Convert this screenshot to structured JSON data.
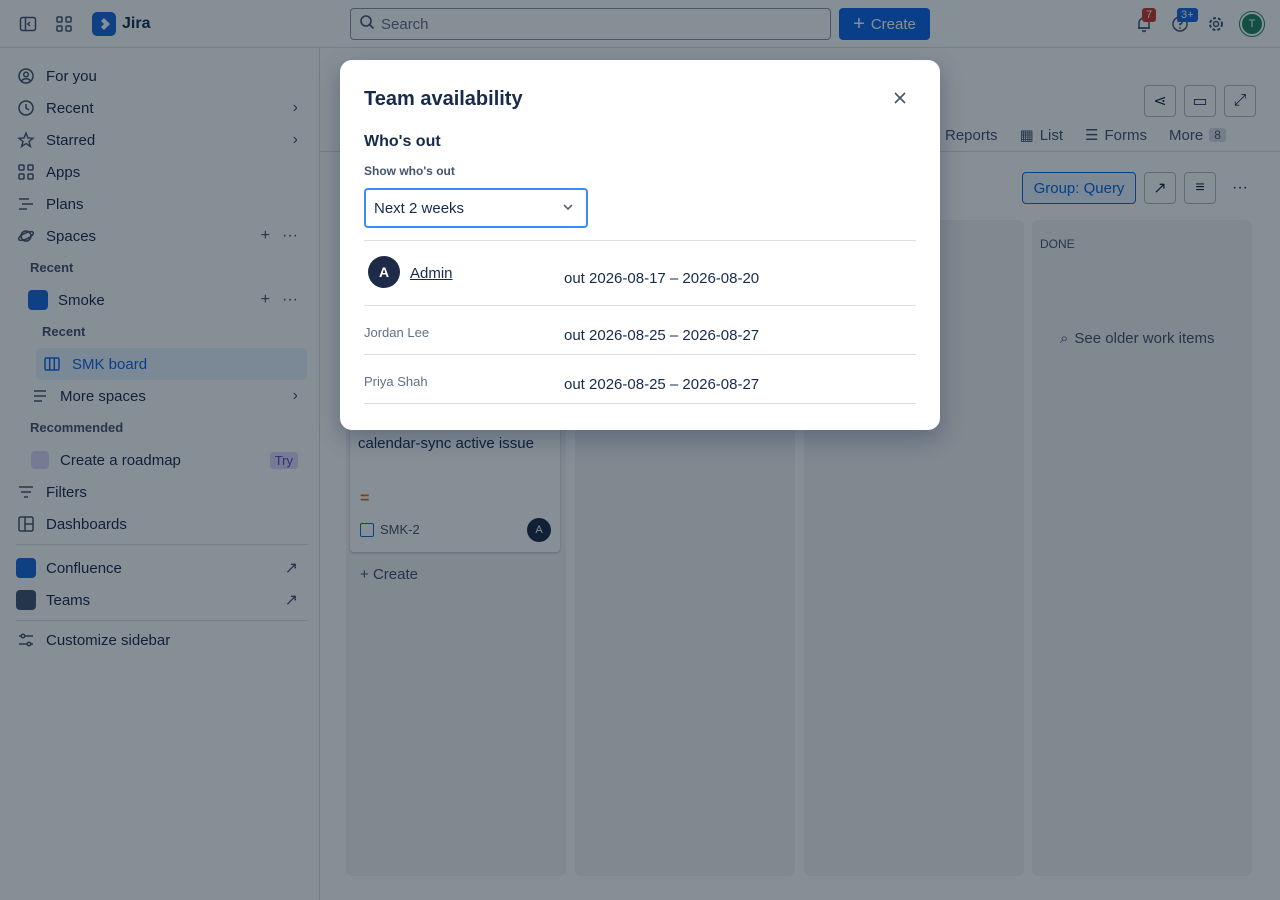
{
  "topbar": {
    "app_name": "Jira",
    "search_placeholder": "Search",
    "create_label": "Create",
    "notifications_count": "7",
    "help_count": "3+",
    "user_initial": "T"
  },
  "sidebar": {
    "items": [
      {
        "label": "For you",
        "icon": "person-circle-icon"
      },
      {
        "label": "Recent",
        "icon": "clock-icon"
      },
      {
        "label": "Starred",
        "icon": "star-icon"
      },
      {
        "label": "Apps",
        "icon": "apps-icon"
      },
      {
        "label": "Plans",
        "icon": "plans-icon"
      },
      {
        "label": "Spaces",
        "icon": "spaces-icon"
      }
    ],
    "section_recent": "Recent",
    "space_name": "Smoke",
    "space_recent": "Recent",
    "board_name": "SMK board",
    "more_spaces": "More spaces",
    "section_recommended": "Recommended",
    "roadmap": "Create a roadmap",
    "try_label": "Try",
    "filters": "Filters",
    "dashboards": "Dashboards",
    "confluence": "Confluence",
    "teams": "Teams",
    "customize": "Customize sidebar"
  },
  "main": {
    "tabs": [
      "Reports",
      "List",
      "Forms",
      "More"
    ],
    "more_count": "8",
    "group_label": "Group: Query",
    "done_column": "DONE",
    "older_items": "See older work items",
    "card_title": "calendar-sync active issue",
    "card_key": "SMK-2",
    "card_avatar": "A",
    "create_in_column": "Create"
  },
  "modal": {
    "title": "Team availability",
    "subtitle": "Who's out",
    "filter_label": "Show who's out",
    "filter_value": "Next 2 weeks",
    "rows": [
      {
        "name": "Admin",
        "initial": "A",
        "dates": "out 2026-08-17 – 2026-08-20"
      },
      {
        "name": "Jordan Lee",
        "dates": "out 2026-08-25 – 2026-08-27"
      },
      {
        "name": "Priya Shah",
        "dates": "out 2026-08-25 – 2026-08-27"
      }
    ]
  }
}
